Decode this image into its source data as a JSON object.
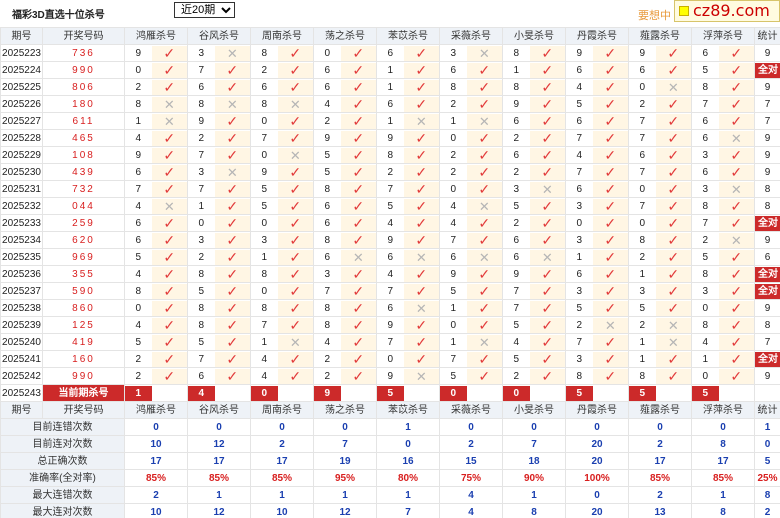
{
  "header": {
    "title": "福彩3D直选十位杀号",
    "period_select": "近20期",
    "period_options": [
      "近20期"
    ],
    "promo_text": "要想中",
    "site_badge": "cz89.com"
  },
  "table": {
    "head": {
      "period": "期号",
      "number": "开奖号码",
      "stat": "统计"
    },
    "experts": [
      "鸿雁杀号",
      "谷风杀号",
      "周南杀号",
      "荡之杀号",
      "苯苡杀号",
      "采薇杀号",
      "小旻杀号",
      "丹霞杀号",
      "薤露杀号",
      "浮萍杀号"
    ],
    "rows": [
      {
        "period": "2025223",
        "number": "736",
        "picks": [
          {
            "v": "9",
            "r": "t"
          },
          {
            "v": "3",
            "r": "x"
          },
          {
            "v": "8",
            "r": "t"
          },
          {
            "v": "0",
            "r": "t"
          },
          {
            "v": "6",
            "r": "t"
          },
          {
            "v": "3",
            "r": "x"
          },
          {
            "v": "8",
            "r": "t"
          },
          {
            "v": "9",
            "r": "t"
          },
          {
            "v": "9",
            "r": "t"
          },
          {
            "v": "6",
            "r": "t"
          }
        ],
        "stat": "9",
        "full": false
      },
      {
        "period": "2025224",
        "number": "990",
        "picks": [
          {
            "v": "0",
            "r": "t"
          },
          {
            "v": "7",
            "r": "t"
          },
          {
            "v": "2",
            "r": "t"
          },
          {
            "v": "6",
            "r": "t"
          },
          {
            "v": "1",
            "r": "t"
          },
          {
            "v": "6",
            "r": "t"
          },
          {
            "v": "1",
            "r": "t"
          },
          {
            "v": "6",
            "r": "t"
          },
          {
            "v": "6",
            "r": "t"
          },
          {
            "v": "5",
            "r": "t"
          }
        ],
        "stat": "全对",
        "full": true
      },
      {
        "period": "2025225",
        "number": "806",
        "picks": [
          {
            "v": "2",
            "r": "t"
          },
          {
            "v": "6",
            "r": "t"
          },
          {
            "v": "6",
            "r": "t"
          },
          {
            "v": "6",
            "r": "t"
          },
          {
            "v": "1",
            "r": "t"
          },
          {
            "v": "8",
            "r": "t"
          },
          {
            "v": "8",
            "r": "t"
          },
          {
            "v": "4",
            "r": "t"
          },
          {
            "v": "0",
            "r": "x"
          },
          {
            "v": "8",
            "r": "t"
          }
        ],
        "stat": "9",
        "full": false
      },
      {
        "period": "2025226",
        "number": "180",
        "picks": [
          {
            "v": "8",
            "r": "x"
          },
          {
            "v": "8",
            "r": "x"
          },
          {
            "v": "8",
            "r": "x"
          },
          {
            "v": "4",
            "r": "t"
          },
          {
            "v": "6",
            "r": "t"
          },
          {
            "v": "2",
            "r": "t"
          },
          {
            "v": "9",
            "r": "t"
          },
          {
            "v": "5",
            "r": "t"
          },
          {
            "v": "2",
            "r": "t"
          },
          {
            "v": "7",
            "r": "t"
          }
        ],
        "stat": "7",
        "full": false
      },
      {
        "period": "2025227",
        "number": "611",
        "picks": [
          {
            "v": "1",
            "r": "x"
          },
          {
            "v": "9",
            "r": "t"
          },
          {
            "v": "0",
            "r": "t"
          },
          {
            "v": "2",
            "r": "t"
          },
          {
            "v": "1",
            "r": "x"
          },
          {
            "v": "1",
            "r": "x"
          },
          {
            "v": "6",
            "r": "t"
          },
          {
            "v": "6",
            "r": "t"
          },
          {
            "v": "7",
            "r": "t"
          },
          {
            "v": "6",
            "r": "t"
          }
        ],
        "stat": "7",
        "full": false
      },
      {
        "period": "2025228",
        "number": "465",
        "picks": [
          {
            "v": "4",
            "r": "t"
          },
          {
            "v": "2",
            "r": "t"
          },
          {
            "v": "7",
            "r": "t"
          },
          {
            "v": "9",
            "r": "t"
          },
          {
            "v": "9",
            "r": "t"
          },
          {
            "v": "0",
            "r": "t"
          },
          {
            "v": "2",
            "r": "t"
          },
          {
            "v": "7",
            "r": "t"
          },
          {
            "v": "7",
            "r": "t"
          },
          {
            "v": "6",
            "r": "x"
          }
        ],
        "stat": "9",
        "full": false
      },
      {
        "period": "2025229",
        "number": "108",
        "picks": [
          {
            "v": "9",
            "r": "t"
          },
          {
            "v": "7",
            "r": "t"
          },
          {
            "v": "0",
            "r": "x"
          },
          {
            "v": "5",
            "r": "t"
          },
          {
            "v": "8",
            "r": "t"
          },
          {
            "v": "2",
            "r": "t"
          },
          {
            "v": "6",
            "r": "t"
          },
          {
            "v": "4",
            "r": "t"
          },
          {
            "v": "6",
            "r": "t"
          },
          {
            "v": "3",
            "r": "t"
          }
        ],
        "stat": "9",
        "full": false
      },
      {
        "period": "2025230",
        "number": "439",
        "picks": [
          {
            "v": "6",
            "r": "t"
          },
          {
            "v": "3",
            "r": "x"
          },
          {
            "v": "9",
            "r": "t"
          },
          {
            "v": "5",
            "r": "t"
          },
          {
            "v": "2",
            "r": "t"
          },
          {
            "v": "2",
            "r": "t"
          },
          {
            "v": "2",
            "r": "t"
          },
          {
            "v": "7",
            "r": "t"
          },
          {
            "v": "7",
            "r": "t"
          },
          {
            "v": "6",
            "r": "t"
          }
        ],
        "stat": "9",
        "full": false
      },
      {
        "period": "2025231",
        "number": "732",
        "picks": [
          {
            "v": "7",
            "r": "t"
          },
          {
            "v": "7",
            "r": "t"
          },
          {
            "v": "5",
            "r": "t"
          },
          {
            "v": "8",
            "r": "t"
          },
          {
            "v": "7",
            "r": "t"
          },
          {
            "v": "0",
            "r": "t"
          },
          {
            "v": "3",
            "r": "x"
          },
          {
            "v": "6",
            "r": "t"
          },
          {
            "v": "0",
            "r": "t"
          },
          {
            "v": "3",
            "r": "x"
          }
        ],
        "stat": "8",
        "full": false
      },
      {
        "period": "2025232",
        "number": "044",
        "picks": [
          {
            "v": "4",
            "r": "x"
          },
          {
            "v": "1",
            "r": "t"
          },
          {
            "v": "5",
            "r": "t"
          },
          {
            "v": "6",
            "r": "t"
          },
          {
            "v": "5",
            "r": "t"
          },
          {
            "v": "4",
            "r": "x"
          },
          {
            "v": "5",
            "r": "t"
          },
          {
            "v": "3",
            "r": "t"
          },
          {
            "v": "7",
            "r": "t"
          },
          {
            "v": "8",
            "r": "t"
          }
        ],
        "stat": "8",
        "full": false
      },
      {
        "period": "2025233",
        "number": "259",
        "picks": [
          {
            "v": "6",
            "r": "t"
          },
          {
            "v": "0",
            "r": "t"
          },
          {
            "v": "0",
            "r": "t"
          },
          {
            "v": "6",
            "r": "t"
          },
          {
            "v": "4",
            "r": "t"
          },
          {
            "v": "4",
            "r": "t"
          },
          {
            "v": "2",
            "r": "t"
          },
          {
            "v": "0",
            "r": "t"
          },
          {
            "v": "0",
            "r": "t"
          },
          {
            "v": "7",
            "r": "t"
          }
        ],
        "stat": "全对",
        "full": true
      },
      {
        "period": "2025234",
        "number": "620",
        "picks": [
          {
            "v": "6",
            "r": "t"
          },
          {
            "v": "3",
            "r": "t"
          },
          {
            "v": "3",
            "r": "t"
          },
          {
            "v": "8",
            "r": "t"
          },
          {
            "v": "9",
            "r": "t"
          },
          {
            "v": "7",
            "r": "t"
          },
          {
            "v": "6",
            "r": "t"
          },
          {
            "v": "3",
            "r": "t"
          },
          {
            "v": "8",
            "r": "t"
          },
          {
            "v": "2",
            "r": "x"
          }
        ],
        "stat": "9",
        "full": false
      },
      {
        "period": "2025235",
        "number": "969",
        "picks": [
          {
            "v": "5",
            "r": "t"
          },
          {
            "v": "2",
            "r": "t"
          },
          {
            "v": "1",
            "r": "t"
          },
          {
            "v": "6",
            "r": "x"
          },
          {
            "v": "6",
            "r": "x"
          },
          {
            "v": "6",
            "r": "x"
          },
          {
            "v": "6",
            "r": "x"
          },
          {
            "v": "1",
            "r": "t"
          },
          {
            "v": "2",
            "r": "t"
          },
          {
            "v": "5",
            "r": "t"
          }
        ],
        "stat": "6",
        "full": false
      },
      {
        "period": "2025236",
        "number": "355",
        "picks": [
          {
            "v": "4",
            "r": "t"
          },
          {
            "v": "8",
            "r": "t"
          },
          {
            "v": "8",
            "r": "t"
          },
          {
            "v": "3",
            "r": "t"
          },
          {
            "v": "4",
            "r": "t"
          },
          {
            "v": "9",
            "r": "t"
          },
          {
            "v": "9",
            "r": "t"
          },
          {
            "v": "6",
            "r": "t"
          },
          {
            "v": "1",
            "r": "t"
          },
          {
            "v": "8",
            "r": "t"
          }
        ],
        "stat": "全对",
        "full": true
      },
      {
        "period": "2025237",
        "number": "590",
        "picks": [
          {
            "v": "8",
            "r": "t"
          },
          {
            "v": "5",
            "r": "t"
          },
          {
            "v": "0",
            "r": "t"
          },
          {
            "v": "7",
            "r": "t"
          },
          {
            "v": "7",
            "r": "t"
          },
          {
            "v": "5",
            "r": "t"
          },
          {
            "v": "7",
            "r": "t"
          },
          {
            "v": "3",
            "r": "t"
          },
          {
            "v": "3",
            "r": "t"
          },
          {
            "v": "3",
            "r": "t"
          }
        ],
        "stat": "全对",
        "full": true
      },
      {
        "period": "2025238",
        "number": "860",
        "picks": [
          {
            "v": "0",
            "r": "t"
          },
          {
            "v": "8",
            "r": "t"
          },
          {
            "v": "8",
            "r": "t"
          },
          {
            "v": "8",
            "r": "t"
          },
          {
            "v": "6",
            "r": "x"
          },
          {
            "v": "1",
            "r": "t"
          },
          {
            "v": "7",
            "r": "t"
          },
          {
            "v": "5",
            "r": "t"
          },
          {
            "v": "5",
            "r": "t"
          },
          {
            "v": "0",
            "r": "t"
          }
        ],
        "stat": "9",
        "full": false
      },
      {
        "period": "2025239",
        "number": "125",
        "picks": [
          {
            "v": "4",
            "r": "t"
          },
          {
            "v": "8",
            "r": "t"
          },
          {
            "v": "7",
            "r": "t"
          },
          {
            "v": "8",
            "r": "t"
          },
          {
            "v": "9",
            "r": "t"
          },
          {
            "v": "0",
            "r": "t"
          },
          {
            "v": "5",
            "r": "t"
          },
          {
            "v": "2",
            "r": "x"
          },
          {
            "v": "2",
            "r": "x"
          },
          {
            "v": "8",
            "r": "t"
          }
        ],
        "stat": "8",
        "full": false
      },
      {
        "period": "2025240",
        "number": "419",
        "picks": [
          {
            "v": "5",
            "r": "t"
          },
          {
            "v": "5",
            "r": "t"
          },
          {
            "v": "1",
            "r": "x"
          },
          {
            "v": "4",
            "r": "t"
          },
          {
            "v": "7",
            "r": "t"
          },
          {
            "v": "1",
            "r": "x"
          },
          {
            "v": "4",
            "r": "t"
          },
          {
            "v": "7",
            "r": "t"
          },
          {
            "v": "1",
            "r": "x"
          },
          {
            "v": "4",
            "r": "t"
          }
        ],
        "stat": "7",
        "full": false
      },
      {
        "period": "2025241",
        "number": "160",
        "picks": [
          {
            "v": "2",
            "r": "t"
          },
          {
            "v": "7",
            "r": "t"
          },
          {
            "v": "4",
            "r": "t"
          },
          {
            "v": "2",
            "r": "t"
          },
          {
            "v": "0",
            "r": "t"
          },
          {
            "v": "7",
            "r": "t"
          },
          {
            "v": "5",
            "r": "t"
          },
          {
            "v": "3",
            "r": "t"
          },
          {
            "v": "1",
            "r": "t"
          },
          {
            "v": "1",
            "r": "t"
          }
        ],
        "stat": "全对",
        "full": true
      },
      {
        "period": "2025242",
        "number": "990",
        "picks": [
          {
            "v": "2",
            "r": "t"
          },
          {
            "v": "6",
            "r": "t"
          },
          {
            "v": "4",
            "r": "t"
          },
          {
            "v": "2",
            "r": "t"
          },
          {
            "v": "9",
            "r": "x"
          },
          {
            "v": "5",
            "r": "t"
          },
          {
            "v": "2",
            "r": "t"
          },
          {
            "v": "8",
            "r": "t"
          },
          {
            "v": "8",
            "r": "t"
          },
          {
            "v": "0",
            "r": "t"
          }
        ],
        "stat": "9",
        "full": false
      }
    ],
    "current": {
      "period": "2025243",
      "label": "当前期杀号",
      "picks": [
        "1",
        "4",
        "0",
        "9",
        "5",
        "0",
        "0",
        "5",
        "5",
        "5"
      ]
    },
    "summary_head": {
      "period": "期号",
      "number": "开奖号码",
      "stat": "统计"
    },
    "summary": [
      {
        "label": "目前连错次数",
        "values": [
          "0",
          "0",
          "0",
          "0",
          "1",
          "0",
          "0",
          "0",
          "0",
          "0",
          "1"
        ],
        "pct": false
      },
      {
        "label": "目前连对次数",
        "values": [
          "10",
          "12",
          "2",
          "7",
          "0",
          "2",
          "7",
          "20",
          "2",
          "8",
          "0"
        ],
        "pct": false
      },
      {
        "label": "总正确次数",
        "values": [
          "17",
          "17",
          "17",
          "19",
          "16",
          "15",
          "18",
          "20",
          "17",
          "17",
          "5"
        ],
        "pct": false
      },
      {
        "label": "准确率(全对率)",
        "values": [
          "85%",
          "85%",
          "85%",
          "95%",
          "80%",
          "75%",
          "90%",
          "100%",
          "85%",
          "85%",
          "25%"
        ],
        "pct": true
      },
      {
        "label": "最大连错次数",
        "values": [
          "2",
          "1",
          "1",
          "1",
          "1",
          "4",
          "1",
          "0",
          "2",
          "1",
          "8"
        ],
        "pct": false
      },
      {
        "label": "最大连对次数",
        "values": [
          "10",
          "12",
          "10",
          "12",
          "7",
          "4",
          "8",
          "20",
          "13",
          "8",
          "2"
        ],
        "pct": false
      }
    ]
  }
}
